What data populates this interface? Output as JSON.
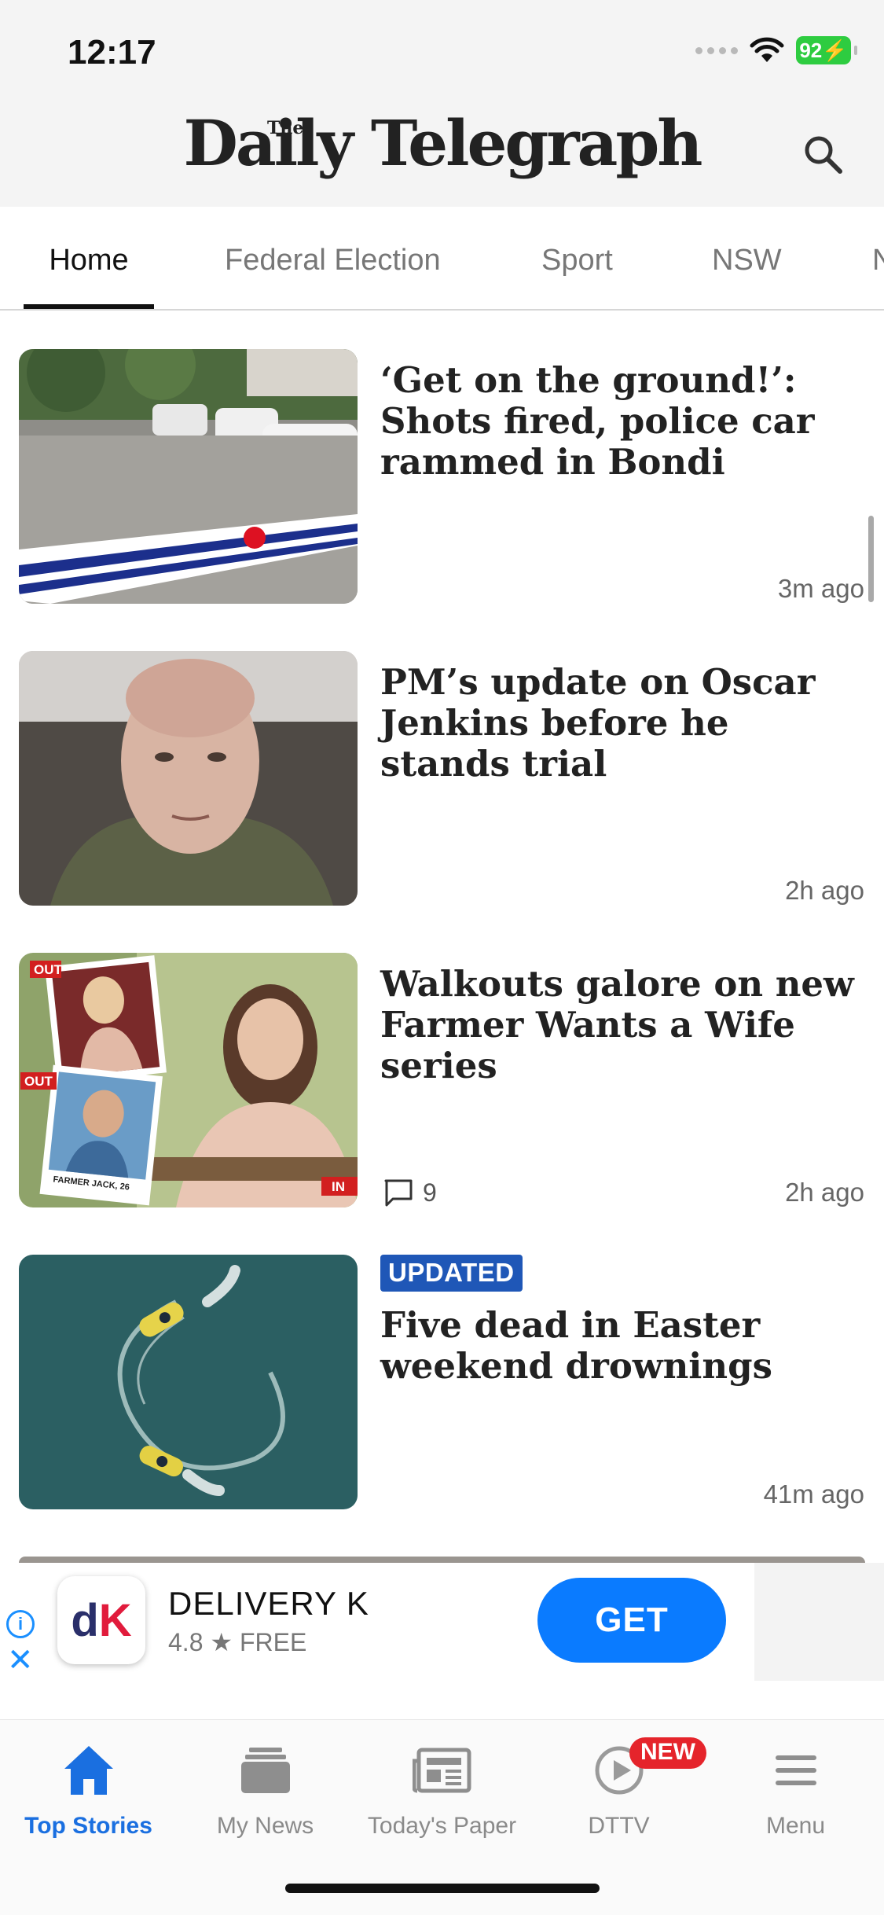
{
  "status": {
    "time": "12:17",
    "battery": "92"
  },
  "header": {
    "logo_the": "The",
    "logo": "Daily Telegraph"
  },
  "tabs": [
    "Home",
    "Federal Election",
    "Sport",
    "NSW",
    "N"
  ],
  "articles": [
    {
      "headline": "‘Get on the ground!’: Shots fired, police car rammed in Bondi",
      "time": "3m  ago"
    },
    {
      "headline": "PM’s update on Oscar Jenkins before he stands trial",
      "time": "2h  ago"
    },
    {
      "headline": "Walkouts galore on new Farmer Wants a Wife series",
      "time": "2h  ago",
      "comments": "9",
      "thumb_labels": {
        "out1": "OUT",
        "out2": "OUT",
        "in": "IN",
        "caption": "FARMER JACK, 26"
      }
    },
    {
      "badge": "UPDATED",
      "headline": "Five dead in Easter weekend drownings",
      "time": "41m  ago"
    }
  ],
  "ad": {
    "info": "i",
    "close": "✕",
    "app_name": "DELIVERY K",
    "rating": "4.8 ★  FREE",
    "button": "GET",
    "icon_d": "d",
    "icon_k": "K"
  },
  "bottom_nav": [
    {
      "label": "Top Stories",
      "icon": "home-icon",
      "active": true
    },
    {
      "label": "My News",
      "icon": "stack-icon"
    },
    {
      "label": "Today's Paper",
      "icon": "newspaper-icon"
    },
    {
      "label": "DTTV",
      "icon": "play-icon",
      "badge": "NEW"
    },
    {
      "label": "Menu",
      "icon": "menu-icon"
    }
  ],
  "colors": {
    "accent": "#1a6fe0",
    "badge_blue": "#1f57b7",
    "new_red": "#e5242b",
    "get_blue": "#0a7bff"
  }
}
